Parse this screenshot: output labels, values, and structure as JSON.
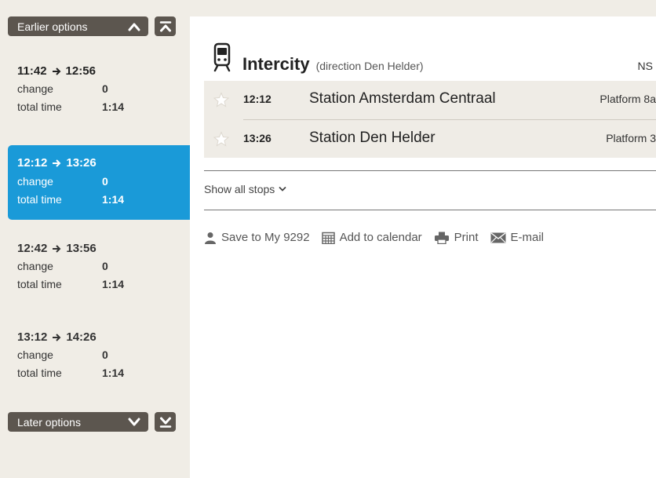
{
  "sidebar": {
    "earlier_label": "Earlier options",
    "later_label": "Later options",
    "options": [
      {
        "depart": "11:42",
        "arrive": "12:56",
        "change_label": "change",
        "change": "0",
        "total_label": "total time",
        "total": "1:14"
      },
      {
        "depart": "12:12",
        "arrive": "13:26",
        "change_label": "change",
        "change": "0",
        "total_label": "total time",
        "total": "1:14"
      },
      {
        "depart": "12:42",
        "arrive": "13:56",
        "change_label": "change",
        "change": "0",
        "total_label": "total time",
        "total": "1:14"
      },
      {
        "depart": "13:12",
        "arrive": "14:26",
        "change_label": "change",
        "change": "0",
        "total_label": "total time",
        "total": "1:14"
      }
    ]
  },
  "service": {
    "name": "Intercity",
    "direction": "(direction Den Helder)",
    "operator": "NS"
  },
  "stops": [
    {
      "time": "12:12",
      "station": "Station Amsterdam Centraal",
      "platform": "Platform 8a"
    },
    {
      "time": "13:26",
      "station": "Station Den Helder",
      "platform": "Platform 3"
    }
  ],
  "show_stops_label": "Show all stops",
  "actions": {
    "save": "Save to My 9292",
    "calendar": "Add to calendar",
    "print": "Print",
    "email": "E-mail"
  },
  "colors": {
    "accent": "#1a9ad8",
    "nav_bg": "#5c564f",
    "sidebar_bg": "#f0ede6",
    "stops_bg": "#efece6"
  },
  "icons": [
    "chevron-up-icon",
    "skip-to-first-icon",
    "chevron-down-icon",
    "skip-to-last-icon",
    "train-icon",
    "star-icon",
    "user-icon",
    "calendar-icon",
    "printer-icon",
    "mail-icon",
    "arrow-right-icon"
  ]
}
